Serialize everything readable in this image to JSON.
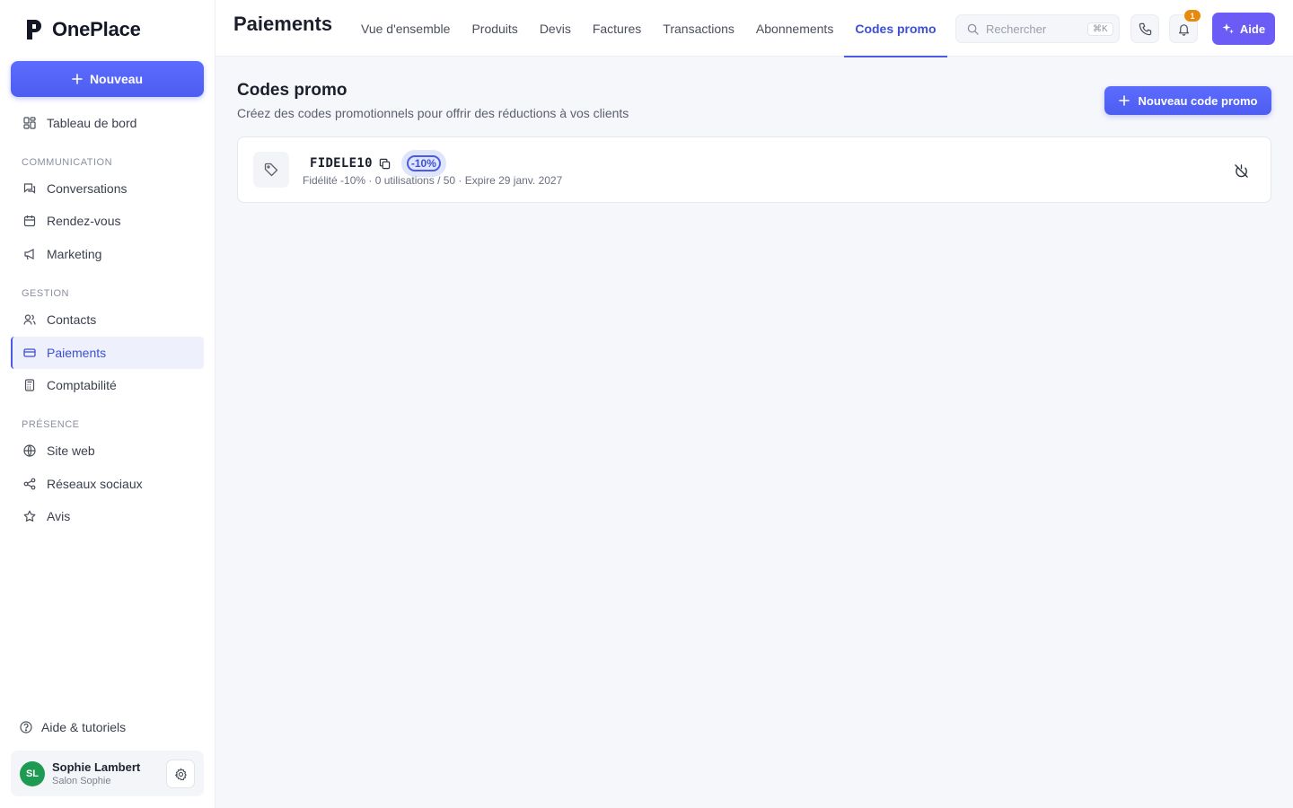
{
  "app": {
    "name": "OnePlace",
    "new_button": "Nouveau"
  },
  "sidebar": {
    "top_item": {
      "label": "Tableau de bord",
      "icon": "dashboard-icon"
    },
    "sections": [
      {
        "label": "COMMUNICATION",
        "items": [
          {
            "label": "Conversations",
            "icon": "chat-icon"
          },
          {
            "label": "Rendez-vous",
            "icon": "calendar-icon"
          },
          {
            "label": "Marketing",
            "icon": "megaphone-icon"
          }
        ]
      },
      {
        "label": "GESTION",
        "items": [
          {
            "label": "Contacts",
            "icon": "users-icon"
          },
          {
            "label": "Paiements",
            "icon": "credit-card-icon",
            "active": true
          },
          {
            "label": "Comptabilité",
            "icon": "calculator-icon"
          }
        ]
      },
      {
        "label": "PRÉSENCE",
        "items": [
          {
            "label": "Site web",
            "icon": "globe-icon"
          },
          {
            "label": "Réseaux sociaux",
            "icon": "share-icon"
          },
          {
            "label": "Avis",
            "icon": "star-icon"
          }
        ]
      }
    ],
    "help_link": "Aide & tutoriels",
    "user": {
      "initials": "SL",
      "name": "Sophie Lambert",
      "org": "Salon Sophie",
      "avatar_color": "#1e9a52"
    }
  },
  "header": {
    "title": "Paiements",
    "tabs": [
      {
        "label": "Vue d'ensemble"
      },
      {
        "label": "Produits"
      },
      {
        "label": "Devis"
      },
      {
        "label": "Factures"
      },
      {
        "label": "Transactions"
      },
      {
        "label": "Abonnements"
      },
      {
        "label": "Codes promo",
        "active": true
      }
    ],
    "search": {
      "placeholder": "Rechercher",
      "shortcut": "⌘K"
    },
    "notifications_count": "1",
    "help_button": "Aide"
  },
  "main": {
    "title": "Codes promo",
    "subtitle": "Créez des codes promotionnels pour offrir des réductions à vos clients",
    "new_code_button": "Nouveau code promo",
    "promo_codes": [
      {
        "code": "FIDELE10",
        "discount": "-10%",
        "meta": "Fidélité -10% · 0 utilisations / 50 · Expire 29 janv. 2027"
      }
    ]
  },
  "colors": {
    "accent": "#4a5be8",
    "help_button": "#6b5cf5",
    "badge": "#e8890c"
  }
}
